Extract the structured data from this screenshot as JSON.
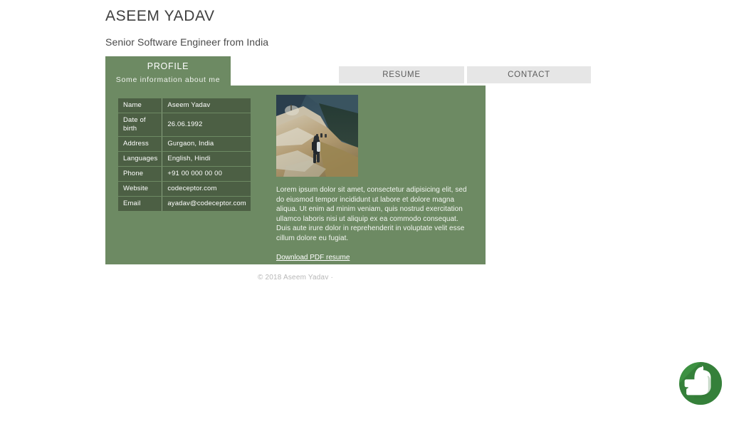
{
  "header": {
    "title": "ASEEM YADAV",
    "subtitle": "Senior Software Engineer from India"
  },
  "tabs": [
    {
      "id": "profile",
      "label": "PROFILE",
      "sub": "Some information about me",
      "active": true
    },
    {
      "id": "resume",
      "label": "RESUME",
      "sub": "",
      "active": false
    },
    {
      "id": "contact",
      "label": "CONTACT",
      "sub": "",
      "active": false
    }
  ],
  "profile": {
    "info_rows": [
      {
        "key": "Name",
        "value": "Aseem Yadav"
      },
      {
        "key": "Date of birth",
        "value": "26.06.1992"
      },
      {
        "key": "Address",
        "value": "Gurgaon, India"
      },
      {
        "key": "Languages",
        "value": "English, Hindi"
      },
      {
        "key": "Phone",
        "value": "+91 00 000 00 00"
      },
      {
        "key": "Website",
        "value": "codeceptor.com"
      },
      {
        "key": "Email",
        "value": "ayadav@codeceptor.com"
      }
    ],
    "photo_alt": "profile-photo-hiker-on-mountain-trail",
    "bio": "Lorem ipsum dolor sit amet, consectetur adipisicing elit, sed do eiusmod tempor incididunt ut labore et dolore magna aliqua. Ut enim ad minim veniam, quis nostrud exercitation ullamco laboris nisi ut aliquip ex ea commodo consequat. Duis aute irure dolor in reprehenderit in voluptate velit esse cillum dolore eu fugiat.",
    "download_label": "Download PDF resume"
  },
  "footer": {
    "copyright": "© 2018 Aseem Yadav ·"
  },
  "watermark": {
    "name": "thumbs-up-logo"
  },
  "colors": {
    "panel_green": "#6d8a63",
    "table_cell": "#4c5f44",
    "tab_inactive": "#e6e6e6",
    "tab_inactive_text": "#5c5c5c",
    "heading_text": "#3f3f3f",
    "footer_text": "#b7b7b7",
    "logo_green": "#3d9142",
    "logo_green_dark": "#2f7334"
  }
}
